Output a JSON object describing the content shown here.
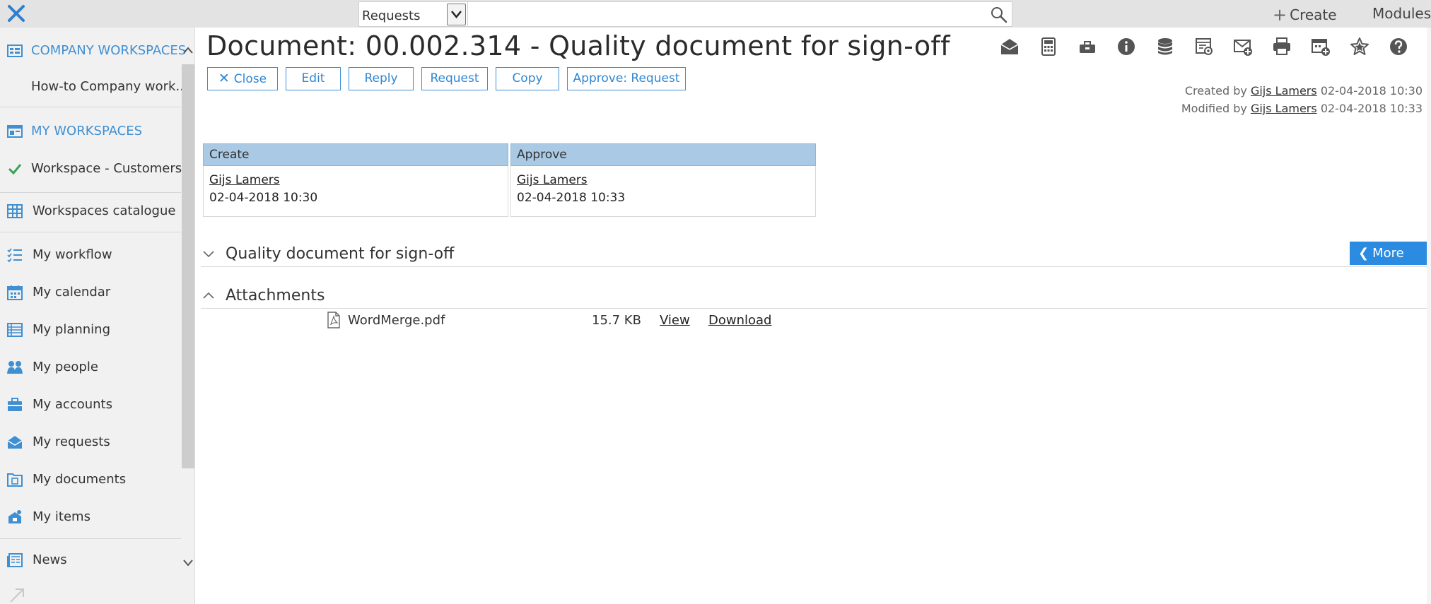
{
  "topbar": {
    "search_type_value": "Requests",
    "search_placeholder": "",
    "create_label": "Create",
    "modules_label": "Modules"
  },
  "sidebar": {
    "items": [
      {
        "label": "COMPANY WORKSPACES",
        "icon": "workspace-icon",
        "style": "section-header"
      },
      {
        "label": "How-to Company work...",
        "icon": "",
        "style": "plain"
      },
      {
        "label": "MY WORKSPACES",
        "icon": "my-workspace-icon",
        "style": "section-header"
      },
      {
        "label": "Workspace - Customers",
        "icon": "checkmark-icon",
        "style": "plain"
      },
      {
        "label": "Workspaces catalogue",
        "icon": "grid-icon",
        "style": "plain"
      },
      {
        "label": "My workflow",
        "icon": "checklist-icon",
        "style": "plain"
      },
      {
        "label": "My calendar",
        "icon": "calendar-icon",
        "style": "plain"
      },
      {
        "label": "My planning",
        "icon": "planning-icon",
        "style": "plain"
      },
      {
        "label": "My people",
        "icon": "people-icon",
        "style": "plain"
      },
      {
        "label": "My accounts",
        "icon": "briefcase-icon",
        "style": "plain"
      },
      {
        "label": "My requests",
        "icon": "request-icon",
        "style": "plain"
      },
      {
        "label": "My documents",
        "icon": "document-icon",
        "style": "plain"
      },
      {
        "label": "My items",
        "icon": "item-icon",
        "style": "plain"
      },
      {
        "label": "News",
        "icon": "news-icon",
        "style": "plain"
      }
    ]
  },
  "document": {
    "title": "Document: 00.002.314 - Quality document for sign-off",
    "actions": [
      "Close",
      "Edit",
      "Reply",
      "Request",
      "Copy",
      "Approve: Request"
    ],
    "toolbar_icons": [
      "open-mail-icon",
      "calculator-icon",
      "toolbox-icon",
      "info-icon",
      "database-icon",
      "preview-icon",
      "mail-add-icon",
      "print-icon",
      "calendar-add-icon",
      "star-icon",
      "help-icon"
    ],
    "created_prefix": "Created by",
    "created_user": "Gijs Lamers",
    "created_date": "02-04-2018 10:30",
    "modified_prefix": "Modified by",
    "modified_user": "Gijs Lamers",
    "modified_date": "02-04-2018 10:33"
  },
  "status_table": {
    "columns": [
      {
        "header": "Create",
        "user": "Gijs Lamers",
        "date": "02-04-2018 10:30"
      },
      {
        "header": "Approve",
        "user": "Gijs Lamers",
        "date": "02-04-2018 10:33"
      }
    ]
  },
  "sections": {
    "main_section": "Quality document for sign-off",
    "more_label": "More",
    "attachments_section": "Attachments"
  },
  "attachments": [
    {
      "file": "WordMerge.pdf",
      "size": "15.7 KB",
      "view": "View",
      "download": "Download"
    }
  ],
  "colors": {
    "accent": "#2a8be0",
    "table_header": "#a9c9e4",
    "sidebar_bg": "#f1f1f1",
    "topbar_bg": "#e3e3e3"
  }
}
